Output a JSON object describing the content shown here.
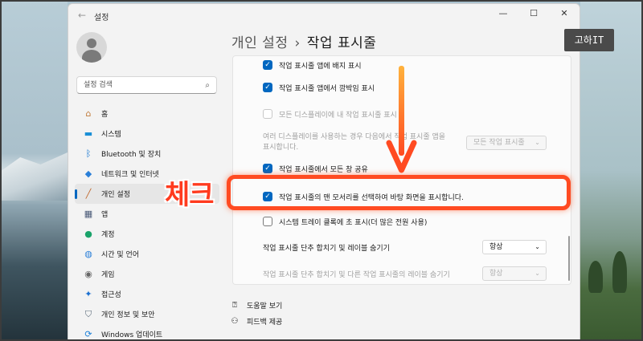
{
  "window": {
    "title": "설정"
  },
  "window_controls": [
    "—",
    "☐",
    "✕"
  ],
  "search": {
    "placeholder": "설정 검색"
  },
  "nav": {
    "items": [
      {
        "label": "홈",
        "icon": "home-icon",
        "glyph": "⌂"
      },
      {
        "label": "시스템",
        "icon": "system-icon",
        "glyph": "▬"
      },
      {
        "label": "Bluetooth 및 장치",
        "icon": "bluetooth-icon",
        "glyph": "ᛒ"
      },
      {
        "label": "네트워크 및 인터넷",
        "icon": "network-icon",
        "glyph": "◆"
      },
      {
        "label": "개인 설정",
        "icon": "brush-icon",
        "glyph": "╱",
        "active": true
      },
      {
        "label": "앱",
        "icon": "apps-icon",
        "glyph": "▦"
      },
      {
        "label": "계정",
        "icon": "account-icon",
        "glyph": "●"
      },
      {
        "label": "시간 및 언어",
        "icon": "globe-icon",
        "glyph": "◍"
      },
      {
        "label": "게임",
        "icon": "gaming-icon",
        "glyph": "◉"
      },
      {
        "label": "접근성",
        "icon": "accessibility-icon",
        "glyph": "✦"
      },
      {
        "label": "개인 정보 및 보안",
        "icon": "shield-icon",
        "glyph": "⛉"
      },
      {
        "label": "Windows 업데이트",
        "icon": "update-icon",
        "glyph": "⟳"
      }
    ]
  },
  "page": {
    "crumb": "개인 설정",
    "separator": "›",
    "title": "작업 표시줄"
  },
  "settings": {
    "badge": "작업 표시줄 앱에 배지 표시",
    "flash": "작업 표시줄 앱에서 깜박임 표시",
    "all_displays": "모든 디스플레이에 내 작업 표시줄 표시",
    "multi_display_line1": "여러 디스플레이를 사용하는 경우 다음에서 작업 표시줄 앱을",
    "multi_display_line2": "표시합니다.",
    "multi_display_value": "모든 작업 표시줄",
    "share_window": "작업 표시줄에서 모든 창 공유",
    "far_corner": "작업 표시줄의 맨 모서리를 선택하여 바탕 화면을 표시합니다.",
    "tray_clock": "시스템 트레이 클록에 초 표시(더 많은 전원 사용)",
    "combine_label": "작업 표시줄 단추 합치기 및 레이블 숨기기",
    "combine_value": "항상",
    "combine_other_label": "작업 표시줄 단추 합치기 및 다른 작업 표시줄의 레이블 숨기기",
    "combine_other_value": "항상"
  },
  "links": {
    "help": "도움말 보기",
    "feedback": "피드백 제공"
  },
  "annotation": {
    "text": "체크"
  },
  "watermark": {
    "text": "고하IT"
  },
  "colors": {
    "accent": "#0067c0",
    "highlight": "#ff4b22"
  }
}
